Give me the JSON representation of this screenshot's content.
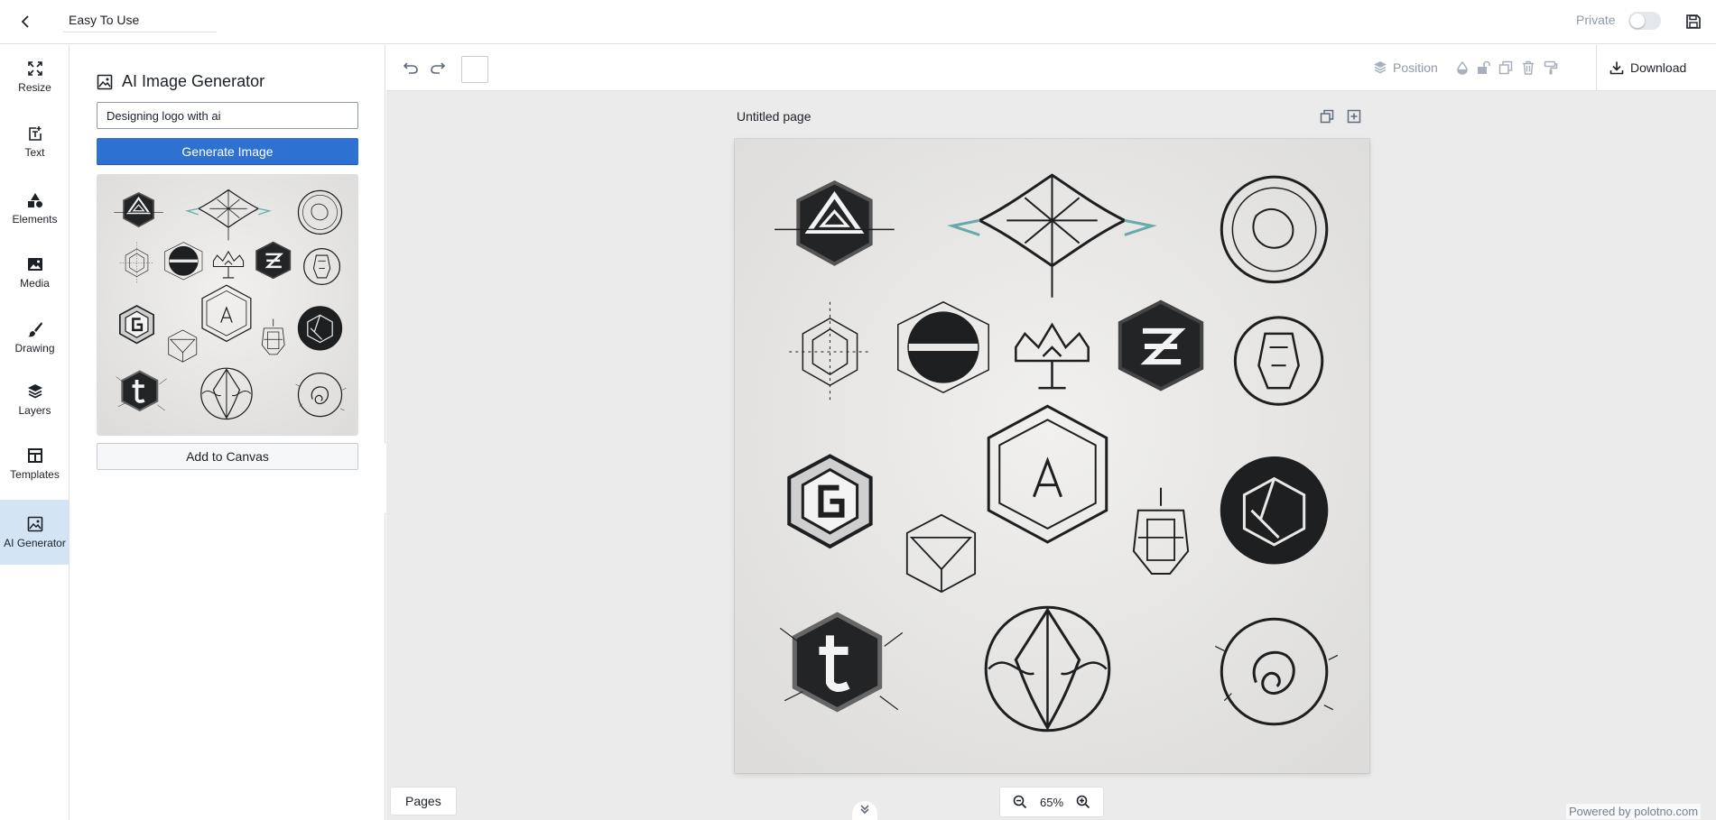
{
  "header": {
    "document_name": "Easy To Use",
    "private_label": "Private",
    "private_enabled": false
  },
  "sidebar": {
    "tabs": [
      {
        "label": "Resize",
        "icon": "fullscreen-icon"
      },
      {
        "label": "Text",
        "icon": "new-text-box-icon"
      },
      {
        "label": "Elements",
        "icon": "shapes-icon"
      },
      {
        "label": "Media",
        "icon": "media-icon"
      },
      {
        "label": "Drawing",
        "icon": "brush-icon"
      },
      {
        "label": "Layers",
        "icon": "layers-icon"
      },
      {
        "label": "Templates",
        "icon": "template-icon"
      },
      {
        "label": "AI Generator",
        "icon": "image-icon",
        "active": true
      }
    ]
  },
  "panel": {
    "title": "AI Image Generator",
    "prompt_value": "Designing logo with ai",
    "generate_label": "Generate Image",
    "add_to_canvas_label": "Add to Canvas"
  },
  "toolbar": {
    "position_label": "Position",
    "download_label": "Download",
    "fill_color": "#ffffff"
  },
  "workspace": {
    "page_title": "Untitled page",
    "pages_label": "Pages",
    "zoom": "65%",
    "credit": "Powered by polotno.com"
  },
  "colors": {
    "accent": "#2d72d2",
    "active_tab": "#d3e4f5",
    "workspace_bg": "#ebebeb",
    "logo_ink": "#1e1f21"
  },
  "artwork": {
    "description_icons": [
      "hexagon-a-logo",
      "winged-logo",
      "circle-ornament-logo",
      "hex-grid-logo",
      "hex-ring-logo",
      "crown-logo",
      "hex-z-logo",
      "circle-helmet-logo",
      "hex-g-logo",
      "hex-frame-a-logo",
      "hex-prism-logo",
      "lantern-logo",
      "circle-hex-logo",
      "hex-t-logo",
      "circle-shield-logo",
      "circle-swirl-logo"
    ],
    "letters": [
      "A",
      "Z",
      "G",
      "A",
      "t"
    ]
  }
}
